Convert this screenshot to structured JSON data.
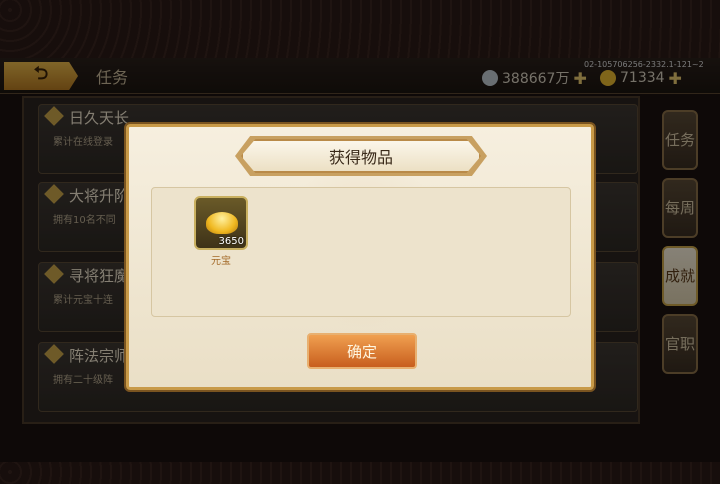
{
  "header": {
    "title": "任务",
    "version": "02-105706256-2332.1-121~2",
    "silver": "388667万",
    "gold": "71334"
  },
  "tasks": [
    {
      "title": "日久天长",
      "desc": "累计在线登录"
    },
    {
      "title": "大将升阶",
      "desc": "拥有10名不同"
    },
    {
      "title": "寻将狂魔",
      "desc": "累计元宝十连"
    },
    {
      "title": "阵法宗师",
      "desc": "拥有二十级阵"
    }
  ],
  "side_tabs": [
    "任务",
    "每周",
    "成就",
    "官职"
  ],
  "dialog": {
    "title": "获得物品",
    "items": [
      {
        "name": "元宝",
        "count": "3650",
        "icon": "gold-ingot-icon"
      }
    ],
    "confirm_label": "确定"
  },
  "colors": {
    "accent": "#c85e1e",
    "border": "#c89a48"
  }
}
